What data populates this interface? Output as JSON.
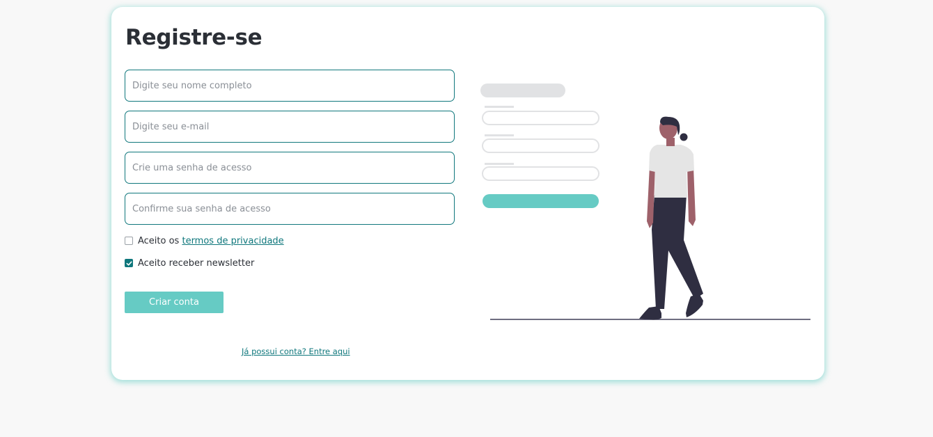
{
  "form": {
    "title": "Registre-se",
    "name_placeholder": "Digite seu nome completo",
    "email_placeholder": "Digite seu e-mail",
    "password_placeholder": "Crie uma senha de acesso",
    "confirm_placeholder": "Confirme sua senha de acesso",
    "terms_prefix": "Aceito os ",
    "terms_link": "termos de privacidade",
    "terms_checked": false,
    "newsletter_label": "Aceito receber newsletter",
    "newsletter_checked": true,
    "submit_label": "Criar conta",
    "login_link": "Já possui conta? Entre aqui"
  },
  "colors": {
    "accent": "#0f777c",
    "button": "#66cbc4",
    "title": "#2b2f36",
    "background": "#f8f8f8",
    "card_shadow": "#66cdc4"
  },
  "illustration": {
    "icon": "person-standing-signup-illustration"
  }
}
